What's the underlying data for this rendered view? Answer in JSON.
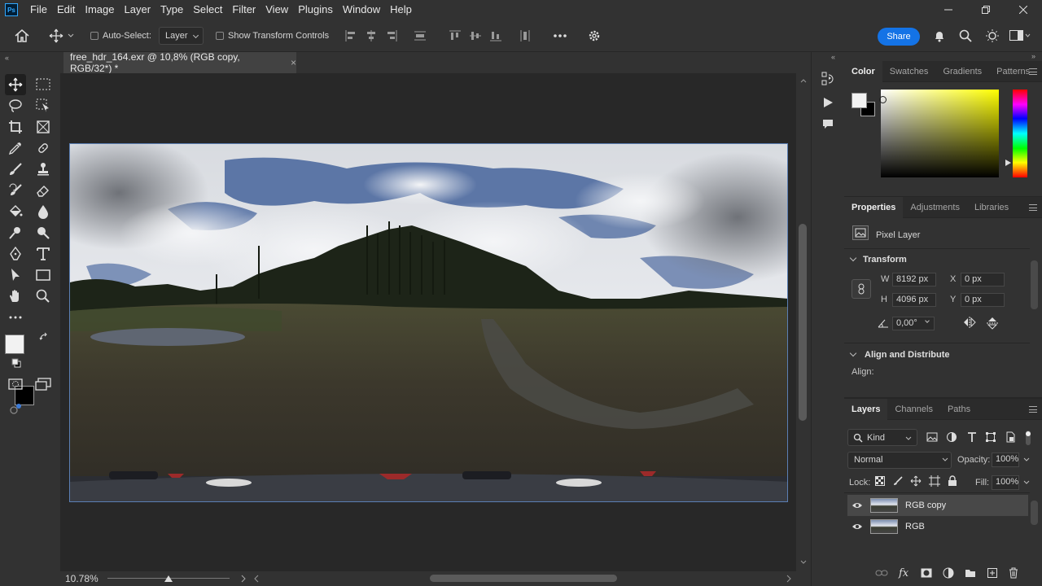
{
  "app": {
    "logo": "Ps"
  },
  "menu": [
    "File",
    "Edit",
    "Image",
    "Layer",
    "Type",
    "Select",
    "Filter",
    "View",
    "Plugins",
    "Window",
    "Help"
  ],
  "options": {
    "auto_select_label": "Auto-Select:",
    "auto_select_value": "Layer",
    "show_transform_label": "Show Transform Controls",
    "share_label": "Share"
  },
  "document": {
    "tab_title": "free_hdr_164.exr @ 10,8% (RGB copy, RGB/32*) *",
    "tab_close": "×",
    "zoom": "10.78%"
  },
  "color_panel": {
    "tabs": [
      "Color",
      "Swatches",
      "Gradients",
      "Patterns"
    ],
    "active_tab": "Color",
    "foreground": "#f2f2f2",
    "background": "#000000"
  },
  "properties_panel": {
    "tabs": [
      "Properties",
      "Adjustments",
      "Libraries"
    ],
    "layer_type": "Pixel Layer",
    "transform_title": "Transform",
    "w_label": "W",
    "w_value": "8192 px",
    "h_label": "H",
    "h_value": "4096 px",
    "x_label": "X",
    "x_value": "0 px",
    "y_label": "Y",
    "y_value": "0 px",
    "angle_value": "0,00°",
    "align_title": "Align and Distribute",
    "align_label": "Align:"
  },
  "layers_panel": {
    "tabs": [
      "Layers",
      "Channels",
      "Paths"
    ],
    "filter_kind": "Kind",
    "blend_mode": "Normal",
    "opacity_label": "Opacity:",
    "opacity_value": "100%",
    "lock_label": "Lock:",
    "fill_label": "Fill:",
    "fill_value": "100%",
    "layers": [
      {
        "name": "RGB copy",
        "selected": true
      },
      {
        "name": "RGB",
        "selected": false
      }
    ]
  }
}
